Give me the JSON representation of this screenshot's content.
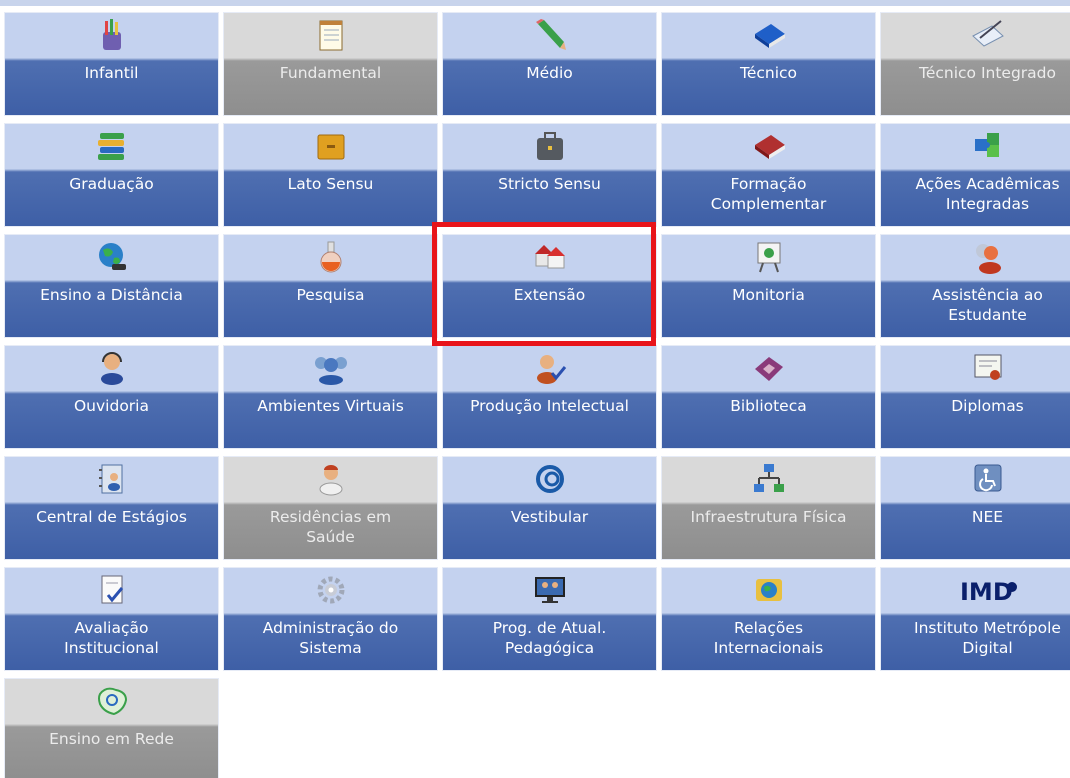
{
  "tiles": [
    {
      "label": "Infantil",
      "icon": "pencil-cup-icon",
      "enabled": true
    },
    {
      "label": "Fundamental",
      "icon": "notepad-icon",
      "enabled": false
    },
    {
      "label": "Médio",
      "icon": "green-pencil-icon",
      "enabled": true
    },
    {
      "label": "Técnico",
      "icon": "blue-book-icon",
      "enabled": true
    },
    {
      "label": "Técnico Integrado",
      "icon": "writing-paper-icon",
      "enabled": false
    },
    {
      "label": "Graduação",
      "icon": "book-stack-icon",
      "enabled": true
    },
    {
      "label": "Lato Sensu",
      "icon": "yellow-folder-icon",
      "enabled": true
    },
    {
      "label": "Stricto Sensu",
      "icon": "briefcase-icon",
      "enabled": true
    },
    {
      "label": "Formação\nComplementar",
      "icon": "red-book-icon",
      "enabled": true
    },
    {
      "label": "Ações Acadêmicas\nIntegradas",
      "icon": "puzzle-icon",
      "enabled": true
    },
    {
      "label": "Ensino a Distância",
      "icon": "globe-icon",
      "enabled": true
    },
    {
      "label": "Pesquisa",
      "icon": "flask-icon",
      "enabled": true
    },
    {
      "label": "Extensão",
      "icon": "houses-icon",
      "enabled": true
    },
    {
      "label": "Monitoria",
      "icon": "presentation-board-icon",
      "enabled": true
    },
    {
      "label": "Assistência ao\nEstudante",
      "icon": "users-icon",
      "enabled": true
    },
    {
      "label": "Ouvidoria",
      "icon": "headset-user-icon",
      "enabled": true
    },
    {
      "label": "Ambientes Virtuais",
      "icon": "user-group-icon",
      "enabled": true
    },
    {
      "label": "Produção Intelectual",
      "icon": "user-check-icon",
      "enabled": true
    },
    {
      "label": "Biblioteca",
      "icon": "open-book-icon",
      "enabled": true
    },
    {
      "label": "Diplomas",
      "icon": "certificate-icon",
      "enabled": true
    },
    {
      "label": "Central de Estágios",
      "icon": "address-book-icon",
      "enabled": true
    },
    {
      "label": "Residências em\nSaúde",
      "icon": "doctor-icon",
      "enabled": false
    },
    {
      "label": "Vestibular",
      "icon": "swirl-icon",
      "enabled": true
    },
    {
      "label": "Infraestrutura Física",
      "icon": "network-icon",
      "enabled": false
    },
    {
      "label": "NEE",
      "icon": "accessibility-icon",
      "enabled": true
    },
    {
      "label": "Avaliação\nInstitucional",
      "icon": "document-check-icon",
      "enabled": true
    },
    {
      "label": "Administração do\nSistema",
      "icon": "gears-icon",
      "enabled": true
    },
    {
      "label": "Prog. de Atual.\nPedagógica",
      "icon": "monitor-people-icon",
      "enabled": true
    },
    {
      "label": "Relações\nInternacionais",
      "icon": "globe-card-icon",
      "enabled": true
    },
    {
      "label": "Instituto Metrópole\nDigital",
      "icon": "imd-logo-icon",
      "enabled": true
    },
    {
      "label": "Ensino em Rede",
      "icon": "brazil-map-icon",
      "enabled": false
    }
  ],
  "highlighted_tile": "Extensão",
  "colors": {
    "tile_top": "#c4d2ef",
    "tile_bottom": "#3e5fa6",
    "disabled_top": "#d9d9d9",
    "disabled_bottom": "#8e8e8e",
    "highlight": "#e8141a"
  }
}
